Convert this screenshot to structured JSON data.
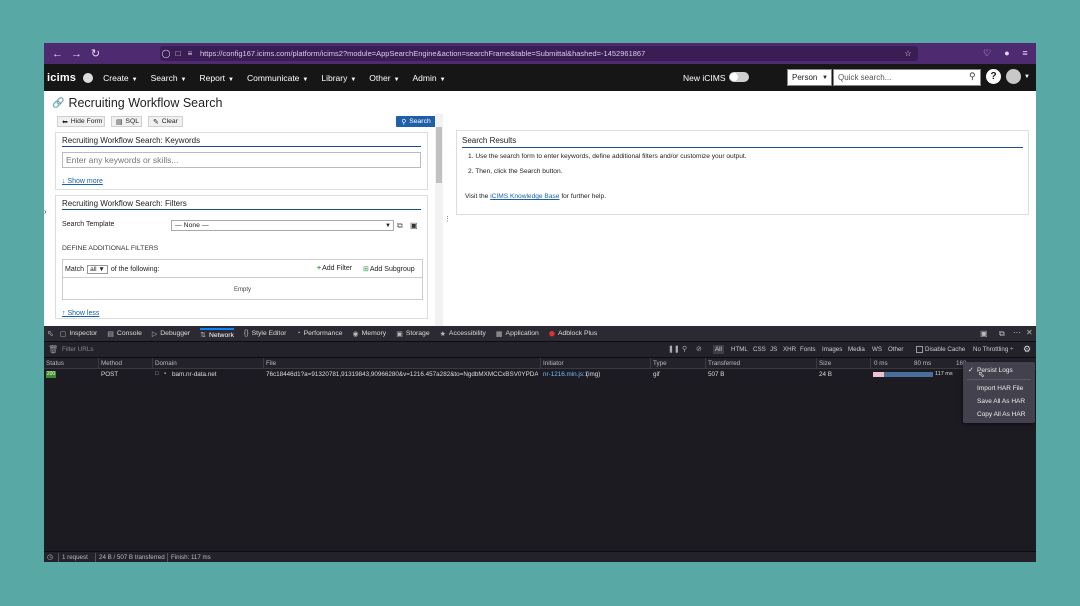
{
  "browser": {
    "url": "https://config167.icims.com/platform/icims2?module=AppSearchEngine&action=searchFrame&table=Submittal&hashed=-1452961867",
    "icons": [
      "back-icon",
      "forward-icon",
      "reload-icon",
      "shield-icon",
      "lock-icon",
      "permissions-icon",
      "bookmark-star-icon",
      "pocket-icon",
      "extension-icon",
      "menu-icon"
    ]
  },
  "appnav": {
    "logo": "icims",
    "menus": [
      "Create",
      "Search",
      "Report",
      "Communicate",
      "Library",
      "Other",
      "Admin"
    ],
    "new_icims_label": "New iCIMS",
    "person_select": "Person",
    "quick_search_placeholder": "Quick search...",
    "help_label": "?"
  },
  "page": {
    "title": "Recruiting Workflow Search",
    "toolbar": {
      "hide_form": "Hide Form",
      "sql": "SQL",
      "clear": "Clear",
      "search": "Search"
    },
    "keywords_panel": {
      "title": "Recruiting Workflow Search: Keywords",
      "input_placeholder": "Enter any keywords or skills...",
      "show_more": "↓ Show more"
    },
    "filters_panel": {
      "title": "Recruiting Workflow Search: Filters",
      "search_template_label": "Search Template",
      "search_template_value": "— None —",
      "define_label": "DEFINE ADDITIONAL FILTERS",
      "match_prefix": "Match",
      "match_value": "all",
      "match_suffix": "of the following:",
      "add_filter": "Add Filter",
      "add_subgroup": "Add Subgroup",
      "empty_text": "Empty",
      "show_less": "↑ Show less"
    },
    "results": {
      "title": "Search Results",
      "step1": "1. Use the search form to enter keywords, define additional filters and/or customize your output.",
      "step2": "2. Then, click the Search button.",
      "visit_prefix": "Visit the",
      "kb_link": "iCIMS Knowledge Base",
      "visit_suffix": "for further help."
    }
  },
  "devtools": {
    "tabs": [
      {
        "label": "Inspector",
        "icon": "inspector-icon"
      },
      {
        "label": "Console",
        "icon": "console-icon"
      },
      {
        "label": "Debugger",
        "icon": "debugger-icon"
      },
      {
        "label": "Network",
        "icon": "network-icon"
      },
      {
        "label": "Style Editor",
        "icon": "style-editor-icon"
      },
      {
        "label": "Performance",
        "icon": "performance-icon"
      },
      {
        "label": "Memory",
        "icon": "memory-icon"
      },
      {
        "label": "Storage",
        "icon": "storage-icon"
      },
      {
        "label": "Accessibility",
        "icon": "accessibility-icon"
      },
      {
        "label": "Application",
        "icon": "application-icon"
      },
      {
        "label": "Adblock Plus",
        "icon": "adblock-icon"
      }
    ],
    "selected_tab": "Network",
    "filter_placeholder": "Filter URLs",
    "type_filters": [
      "All",
      "HTML",
      "CSS",
      "JS",
      "XHR",
      "Fonts",
      "Images",
      "Media",
      "WS",
      "Other"
    ],
    "disable_cache": "Disable Cache",
    "throttling": "No Throttling ÷",
    "columns": [
      "Status",
      "Method",
      "Domain",
      "File",
      "Initiator",
      "Type",
      "Transferred",
      "Size",
      "0 ms",
      "80 ms",
      "160"
    ],
    "row": {
      "status": "200",
      "method": "POST",
      "domain": "bam.nr-data.net",
      "file": "76c18446d1?a=91320781,91319843,90966280&v=1216.457a282&to=NgdbMXMCCxBSV0YPDA9NehZCFxc",
      "initiator": "nr-1216.min.js:1",
      "initiator_suffix": "(img)",
      "type": "gif",
      "transferred": "507 B",
      "size": "24 B",
      "timing": "117 ms"
    },
    "menu": {
      "persist_logs": "Persist Logs",
      "import_har": "Import HAR File",
      "save_har": "Save All As HAR",
      "copy_har": "Copy All As HAR"
    },
    "status": {
      "requests": "1 request",
      "transferred": "24 B / 507 B transferred",
      "finish": "Finish: 117 ms"
    }
  },
  "colors": {
    "browser_bar": "#4e2a70",
    "app_nav": "#161616",
    "accent": "#1f5ea8",
    "devtools_bg": "#1c1b22",
    "status_ok": "#3d8b2e"
  }
}
